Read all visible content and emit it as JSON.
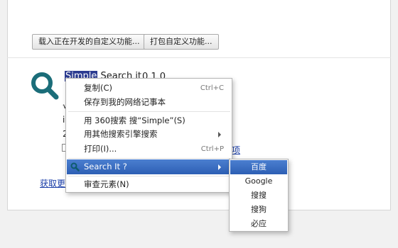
{
  "toolbar": {
    "load_unpacked_label": "载入正在开发的自定义功能...",
    "pack_label": "打包自定义功能..."
  },
  "extension": {
    "name_selected": "Simple",
    "name_rest": " Search it",
    "version": "0.1.0",
    "icon": "magnifier-icon",
    "icon_color": "#1b6d79"
  },
  "background": {
    "options_link_tail": "项",
    "get_more_link": "获取更",
    "fragments": [
      "√",
      "i",
      "2"
    ]
  },
  "context_menu": {
    "items": [
      {
        "label": "复制(C)",
        "shortcut": "Ctrl+C"
      },
      {
        "label": "保存到我的网络记事本",
        "shortcut": ""
      },
      {
        "label": "用 360搜索 搜“Simple”(S)",
        "shortcut": ""
      },
      {
        "label": "用其他搜索引擎搜索",
        "shortcut": ""
      },
      {
        "label": "打印(I)...",
        "shortcut": "Ctrl+P"
      },
      {
        "label": "Search It ?",
        "shortcut": "",
        "icon": "search-icon"
      },
      {
        "label": "审查元素(N)",
        "shortcut": ""
      }
    ]
  },
  "submenu": {
    "items": [
      "百度",
      "Google",
      "搜搜",
      "搜狗",
      "必应"
    ]
  },
  "colors": {
    "highlight": "#2d5fb4",
    "link": "#1a3ea8"
  }
}
